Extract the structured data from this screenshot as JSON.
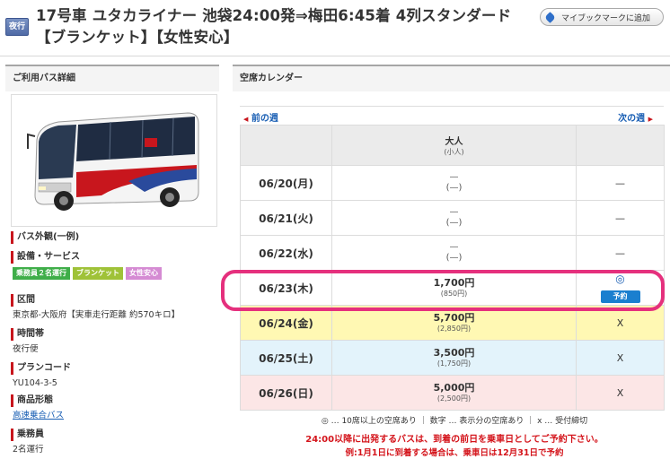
{
  "header": {
    "badge": "夜行",
    "title": "17号車 ユタカライナー 池袋24:00発⇒梅田6:45着 4列スタンダード【ブランケット】【女性安心】",
    "bookmark_label": "マイブックマークに追加"
  },
  "left": {
    "heading": "ご利用バス詳細",
    "photo_caption": "バス外観(一例)",
    "facilities_label": "設備・サービス",
    "tags": [
      {
        "label": "乗務員２名運行",
        "color": "#3fae49"
      },
      {
        "label": "ブランケット",
        "color": "#9fc238"
      },
      {
        "label": "女性安心",
        "color": "#d58bd3"
      }
    ],
    "route_label": "区間",
    "route_value": "東京都-大阪府【実車走行距離 約570キロ】",
    "time_label": "時間帯",
    "time_value": "夜行便",
    "plan_label": "プランコード",
    "plan_value": "YU104-3-5",
    "product_label": "商品形態",
    "product_value": "高速乗合バス",
    "crew_label": "乗務員",
    "crew_value": "2名運行"
  },
  "calendar": {
    "heading": "空席カレンダー",
    "prev_week": "前の週",
    "next_week": "次の週",
    "passenger_type": "大人",
    "passenger_sub": "(小人)",
    "rows": [
      {
        "date": "06/20(月)",
        "price": "—",
        "child_price": "(—)",
        "status": "—",
        "row_color": "white"
      },
      {
        "date": "06/21(火)",
        "price": "—",
        "child_price": "(—)",
        "status": "—",
        "row_color": "white"
      },
      {
        "date": "06/22(水)",
        "price": "—",
        "child_price": "(—)",
        "status": "—",
        "row_color": "white"
      },
      {
        "date": "06/23(木)",
        "price": "1,700円",
        "child_price": "(850円)",
        "status": "◎",
        "reserve": "予約",
        "row_color": "white"
      },
      {
        "date": "06/24(金)",
        "price": "5,700円",
        "child_price": "(2,850円)",
        "status": "X",
        "row_color": "yellow"
      },
      {
        "date": "06/25(土)",
        "price": "3,500円",
        "child_price": "(1,750円)",
        "status": "X",
        "row_color": "blue"
      },
      {
        "date": "06/26(日)",
        "price": "5,000円",
        "child_price": "(2,500円)",
        "status": "X",
        "row_color": "pink"
      }
    ],
    "legend": "◎ … 10席以上の空席あり ｜ 数字 … 表示分の空席あり ｜ x … 受付締切",
    "notice_1": "24:00以降に出発するバスは、到着の前日を乗車日としてご予約下さい。",
    "notice_2": "例:1月1日に到着する場合は、乗車日は12月31日で予約"
  }
}
